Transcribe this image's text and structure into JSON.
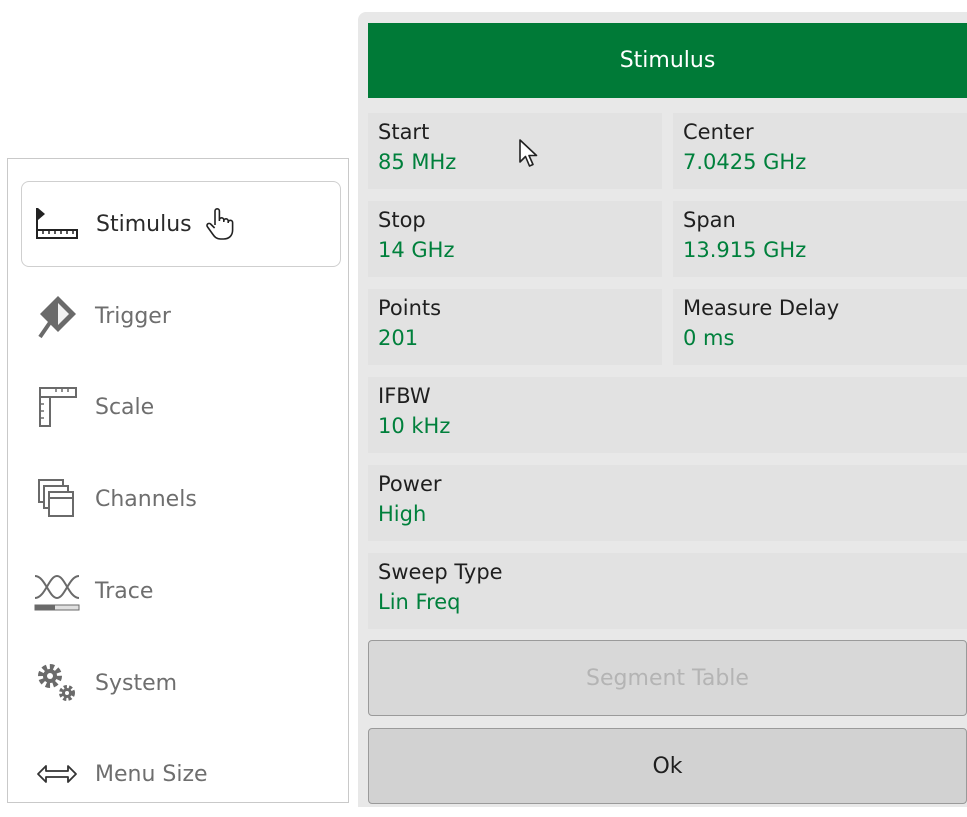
{
  "menu": {
    "items": [
      {
        "label": "Stimulus",
        "icon": "stimulus-ruler-icon",
        "selected": true
      },
      {
        "label": "Trigger",
        "icon": "trigger-icon"
      },
      {
        "label": "Scale",
        "icon": "scale-icon"
      },
      {
        "label": "Channels",
        "icon": "channels-icon"
      },
      {
        "label": "Trace",
        "icon": "trace-icon"
      },
      {
        "label": "System",
        "icon": "gears-icon"
      },
      {
        "label": "Menu Size",
        "icon": "resize-arrows-icon"
      }
    ]
  },
  "panel": {
    "title": "Stimulus",
    "fields": {
      "start": {
        "label": "Start",
        "value": "85 MHz"
      },
      "center": {
        "label": "Center",
        "value": "7.0425 GHz"
      },
      "stop": {
        "label": "Stop",
        "value": "14 GHz"
      },
      "span": {
        "label": "Span",
        "value": "13.915 GHz"
      },
      "points": {
        "label": "Points",
        "value": "201"
      },
      "measure_delay": {
        "label": "Measure Delay",
        "value": "0 ms"
      },
      "ifbw": {
        "label": "IFBW",
        "value": "10 kHz"
      },
      "power": {
        "label": "Power",
        "value": "High"
      },
      "sweep_type": {
        "label": "Sweep Type",
        "value": "Lin Freq"
      }
    },
    "segment_table_label": "Segment Table",
    "ok_label": "Ok"
  },
  "colors": {
    "header_green": "#007a37",
    "value_green": "#00803c",
    "cell_gray": "#e2e2e2"
  }
}
